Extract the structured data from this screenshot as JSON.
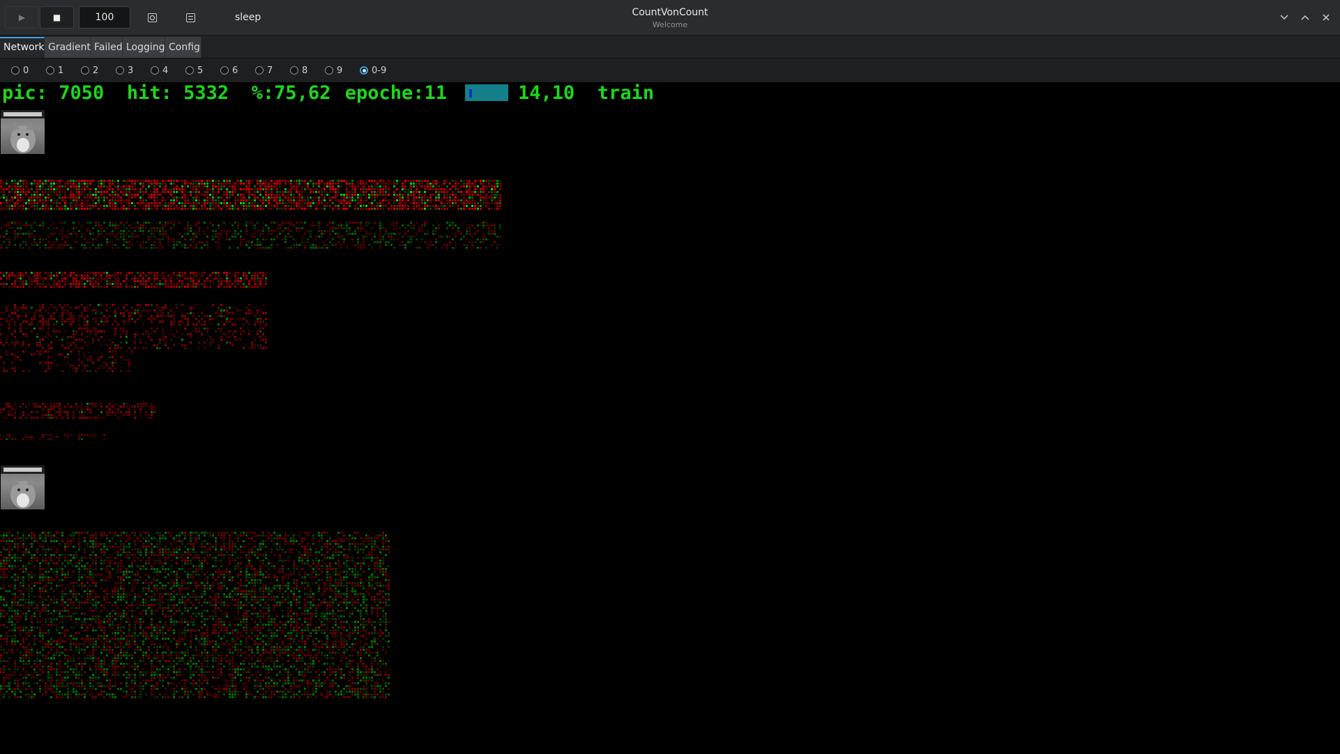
{
  "window": {
    "title": "CountVonCount",
    "subtitle": "Welcome"
  },
  "toolbar": {
    "play_icon": "play-icon",
    "stop_icon": "stop-icon",
    "speed_value": "100",
    "settings_icon": "settings-icon",
    "terminal_icon": "terminal-icon",
    "status": "sleep"
  },
  "window_controls": [
    "chevron-down-icon",
    "chevron-up-icon",
    "close-icon"
  ],
  "tabs": [
    {
      "label": "Network",
      "active": true
    },
    {
      "label": "Gradient",
      "active": false
    },
    {
      "label": "Failed",
      "active": false
    },
    {
      "label": "Logging",
      "active": false
    },
    {
      "label": "Config",
      "active": false
    }
  ],
  "digit_filter": {
    "options": [
      "0",
      "1",
      "2",
      "3",
      "4",
      "5",
      "6",
      "7",
      "8",
      "9",
      "0-9"
    ],
    "selected": "0-9"
  },
  "stats": {
    "pic": "pic: 7050",
    "hit": "hit: 5332",
    "percent": "%:75,62",
    "epoch": "epoche:11",
    "progress_fraction": 0.1,
    "speed": "14,10",
    "mode": "train"
  },
  "colors": {
    "stats_text": "#1bd81b",
    "progress_bg": "#13808a",
    "progress_fill": "#1330c4",
    "active_tab_accent": "#3d9ee5",
    "activation_positive": "#ff1a1a",
    "activation_negative": "#1aff1a"
  }
}
